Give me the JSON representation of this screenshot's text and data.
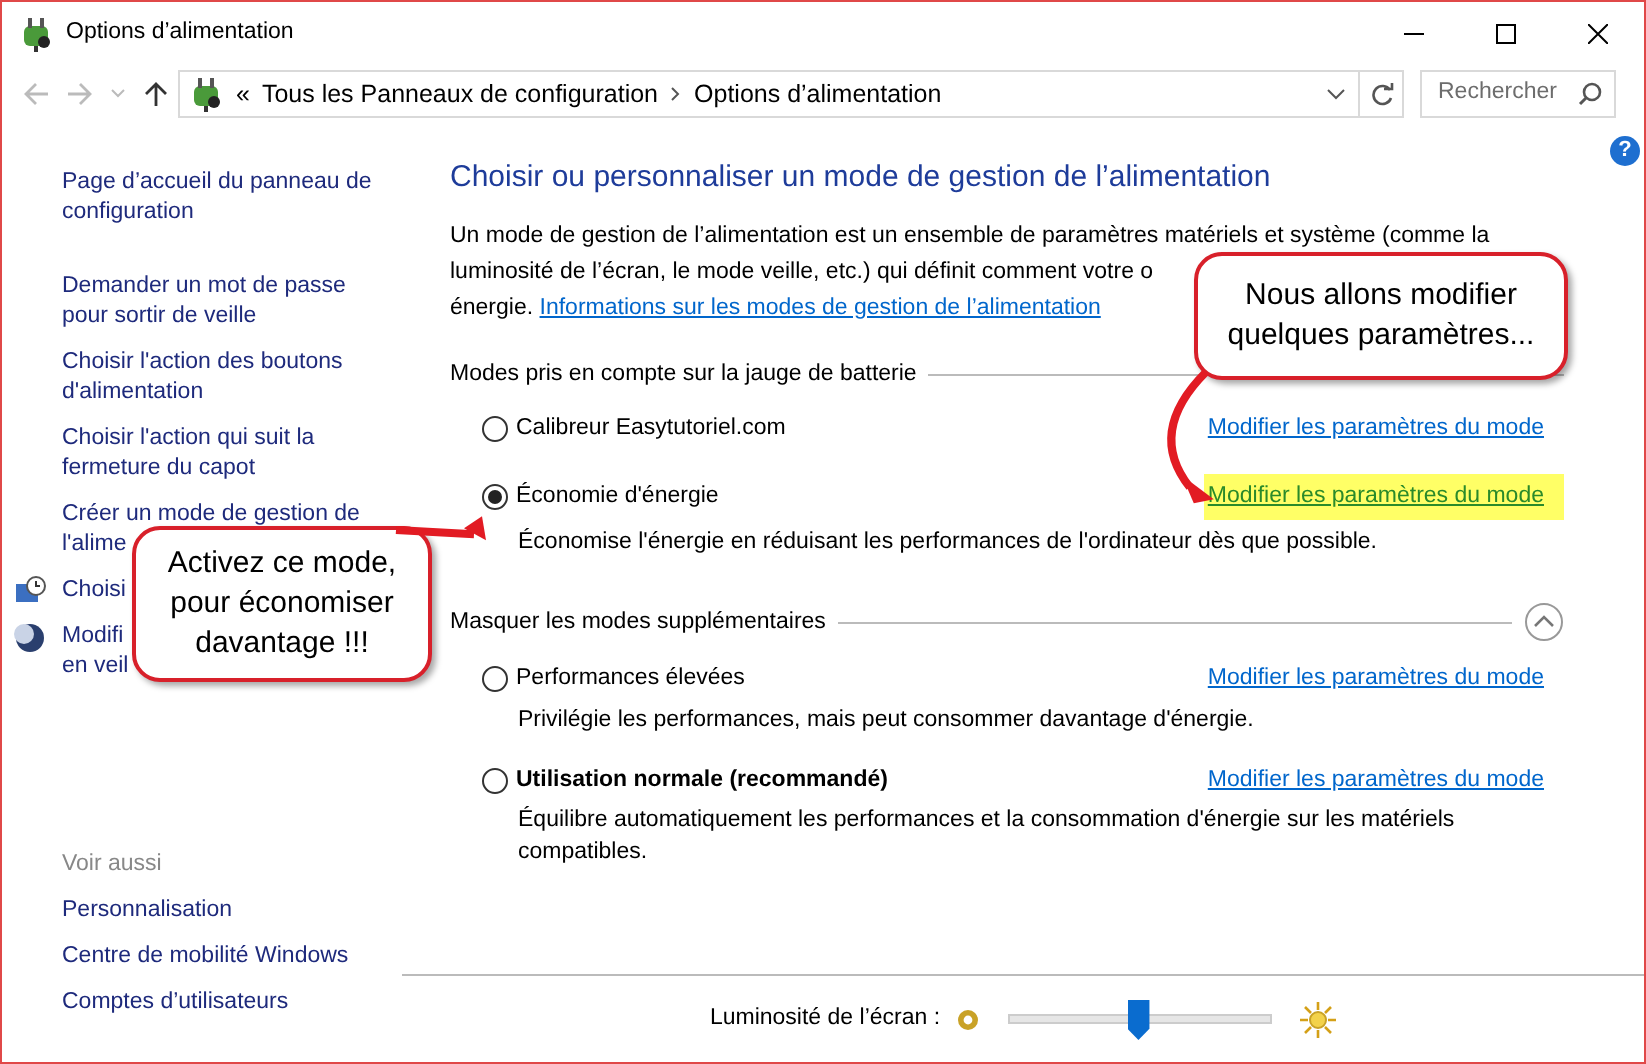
{
  "window": {
    "title": "Options d’alimentation"
  },
  "address_bar": {
    "back_disabled": true,
    "forward_disabled": true,
    "overflow": "«",
    "breadcrumbs": [
      "Tous les Panneaux de configuration",
      "Options d’alimentation"
    ],
    "search": {
      "placeholder": "Rechercher"
    }
  },
  "sidebar": {
    "items": [
      {
        "lines": [
          "Page d’accueil du panneau de",
          "configuration"
        ],
        "kind": "text"
      },
      {
        "lines": [
          "Demander un mot de passe",
          "pour sortir de veille"
        ],
        "kind": "text"
      },
      {
        "lines": [
          "Choisir l'action des boutons",
          "d'alimentation"
        ],
        "kind": "text"
      },
      {
        "lines": [
          "Choisir l'action qui suit la",
          "fermeture du capot"
        ],
        "kind": "text"
      },
      {
        "lines": [
          "Créer un mode de gestion de",
          "l'alime"
        ],
        "kind": "text"
      },
      {
        "lines": [
          "Choisi"
        ],
        "kind": "clock"
      },
      {
        "lines": [
          "Modifi",
          "en veil"
        ],
        "kind": "moon"
      }
    ],
    "see_also": {
      "title": "Voir aussi",
      "links": [
        "Personnalisation",
        "Centre de mobilité Windows",
        "Comptes d’utilisateurs"
      ]
    }
  },
  "main": {
    "heading": "Choisir ou personnaliser un mode de gestion de l’alimentation",
    "description_lines": [
      "Un mode de gestion de l’alimentation est un ensemble de paramètres matériels et système (comme la",
      "luminosité de l’écran, le mode veille, etc.) qui définit comment votre o",
      "énergie."
    ],
    "info_link": "Informations sur les modes de gestion de l’alimentation",
    "groups": [
      {
        "title": "Modes pris en compte sur la jauge de batterie",
        "collapse_button": false,
        "plans": [
          {
            "name": "Calibreur Easytutoriel.com",
            "selected": false,
            "emphasized": false,
            "link": "Modifier les paramètres du mode",
            "highlighted": false
          },
          {
            "name": "Économie d'énergie",
            "selected": true,
            "emphasized": false,
            "description": "Économise l'énergie en réduisant les performances de l'ordinateur dès que possible.",
            "link": "Modifier les paramètres du mode",
            "highlighted": true
          }
        ]
      },
      {
        "title": "Masquer les modes supplémentaires",
        "collapse_button": true,
        "plans": [
          {
            "name": "Performances élevées",
            "selected": false,
            "emphasized": false,
            "description": "Privilégie les performances, mais peut consommer davantage d'énergie.",
            "link": "Modifier les paramètres du mode",
            "highlighted": false
          },
          {
            "name": "Utilisation normale (recommandé)",
            "selected": false,
            "emphasized": true,
            "description": "Équilibre automatiquement les performances et la consommation d'énergie sur les matériels compatibles.",
            "link": "Modifier les paramètres du mode",
            "highlighted": false
          }
        ]
      }
    ]
  },
  "brightness": {
    "label": "Luminosité de l’écran :",
    "level": 0.49
  },
  "callouts": [
    {
      "text": "Activez ce mode, pour économiser davantage !!!",
      "kind": "rising"
    },
    {
      "text": "Nous allons modifier quelques paramètres...",
      "kind": "falling"
    }
  ],
  "help_button": "?"
}
